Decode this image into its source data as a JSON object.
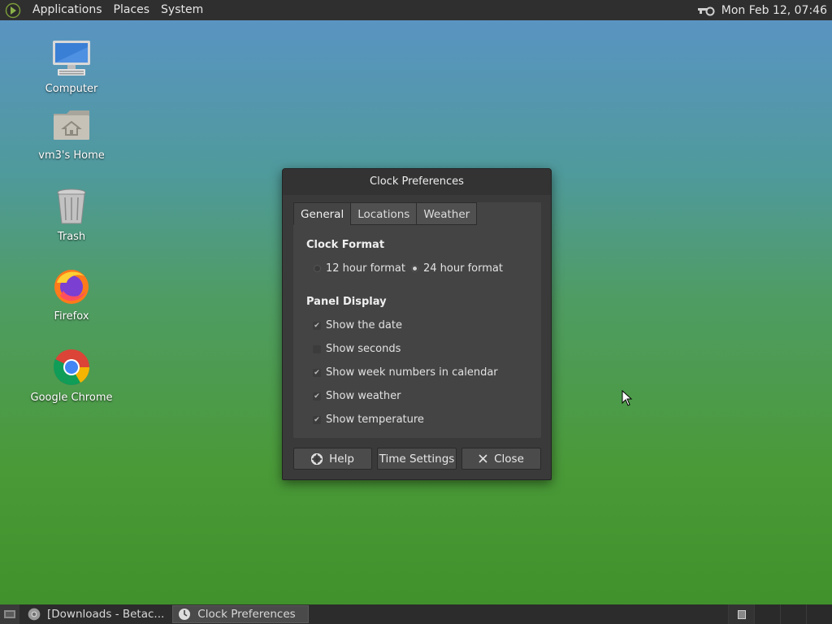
{
  "top_panel": {
    "menus": [
      "Applications",
      "Places",
      "System"
    ],
    "clock": "Mon Feb 12, 07:46"
  },
  "desktop_icons": [
    {
      "label": "Computer",
      "icon": "computer-icon"
    },
    {
      "label": "vm3's Home",
      "icon": "home-folder-icon"
    },
    {
      "label": "Trash",
      "icon": "trash-icon"
    },
    {
      "label": "Firefox",
      "icon": "firefox-icon"
    },
    {
      "label": "Google Chrome",
      "icon": "chrome-icon"
    }
  ],
  "dialog": {
    "title": "Clock Preferences",
    "tabs": [
      "General",
      "Locations",
      "Weather"
    ],
    "active_tab": "General",
    "clock_format": {
      "title": "Clock Format",
      "options": [
        "12 hour format",
        "24 hour format"
      ],
      "selected": "24 hour format"
    },
    "panel_display": {
      "title": "Panel Display",
      "options": [
        {
          "label": "Show the date",
          "checked": true
        },
        {
          "label": "Show seconds",
          "checked": false
        },
        {
          "label": "Show week numbers in calendar",
          "checked": true
        },
        {
          "label": "Show weather",
          "checked": true
        },
        {
          "label": "Show temperature",
          "checked": true
        }
      ]
    },
    "buttons": {
      "help": "Help",
      "time_settings": "Time Settings",
      "close": "Close"
    }
  },
  "taskbar": {
    "tasks": [
      {
        "label": "[Downloads - Betac...",
        "icon": "chrome-icon",
        "active": false
      },
      {
        "label": "Clock Preferences",
        "icon": "clock-icon",
        "active": true
      }
    ]
  },
  "colors": {
    "panel": "#2f2f2f",
    "dialog_bg": "#3a3a3a",
    "notebook_bg": "#444444"
  }
}
